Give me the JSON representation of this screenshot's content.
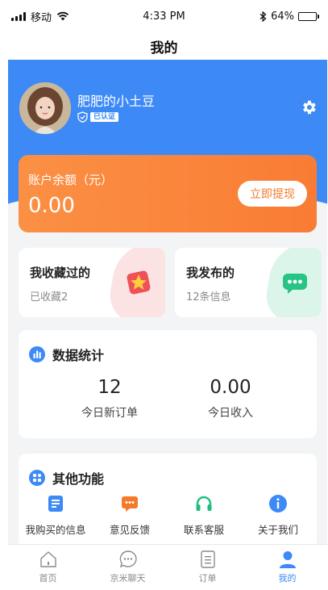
{
  "status_bar": {
    "carrier": "移动",
    "time": "4:33 PM",
    "battery": "64%",
    "battery_level": 0.64
  },
  "nav": {
    "title": "我的"
  },
  "profile": {
    "username": "肥肥的小土豆",
    "verified_label": "已认证"
  },
  "balance": {
    "label": "账户余额（元）",
    "value": "0.00",
    "withdraw_label": "立即提现"
  },
  "favorites": {
    "title": "我收藏过的",
    "subtitle": "已收藏2"
  },
  "published": {
    "title": "我发布的",
    "subtitle": "12条信息"
  },
  "stats": {
    "title": "数据统计",
    "items": [
      {
        "value": "12",
        "label": "今日新订单"
      },
      {
        "value": "0.00",
        "label": "今日收入"
      }
    ]
  },
  "functions": {
    "title": "其他功能",
    "items": [
      {
        "label": "我购买的信息",
        "icon": "document-icon",
        "color": "#3d8af7"
      },
      {
        "label": "意见反馈",
        "icon": "feedback-icon",
        "color": "#f57a2c"
      },
      {
        "label": "联系客服",
        "icon": "headset-icon",
        "color": "#1fbf7a"
      },
      {
        "label": "关于我们",
        "icon": "info-icon",
        "color": "#3d8af7"
      }
    ]
  },
  "tabs": [
    {
      "label": "首页",
      "icon": "home-icon"
    },
    {
      "label": "京米聊天",
      "icon": "chat-icon"
    },
    {
      "label": "订单",
      "icon": "order-icon"
    },
    {
      "label": "我的",
      "icon": "user-icon",
      "active": true
    }
  ],
  "colors": {
    "primary": "#3d8af7",
    "orange": "#f97c34",
    "green": "#1fbf7a",
    "background": "#f3f4f6"
  }
}
